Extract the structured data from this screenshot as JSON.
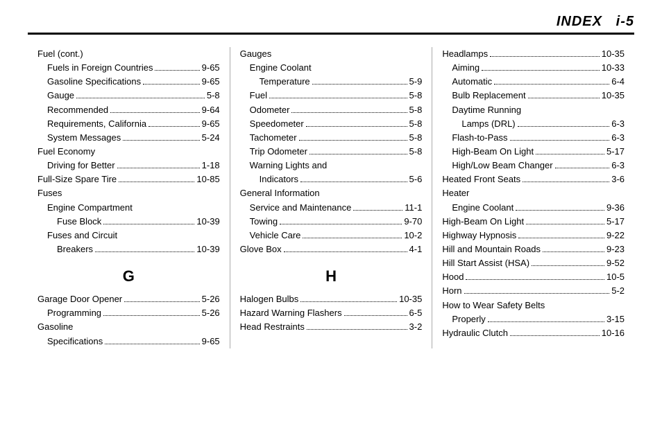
{
  "header": {
    "title": "INDEX",
    "page": "i-5"
  },
  "col1": {
    "entries1": [
      {
        "label": "Fuel (cont.)",
        "page": "",
        "indent": 0,
        "nopage": true
      },
      {
        "label": "Fuels in Foreign Countries",
        "page": "9-65",
        "indent": 1
      },
      {
        "label": "Gasoline Specifications",
        "page": "9-65",
        "indent": 1
      },
      {
        "label": "Gauge",
        "page": "5-8",
        "indent": 1
      },
      {
        "label": "Recommended",
        "page": "9-64",
        "indent": 1
      },
      {
        "label": "Requirements, California",
        "page": "9-65",
        "indent": 1
      },
      {
        "label": "System Messages",
        "page": "5-24",
        "indent": 1
      },
      {
        "label": "Fuel Economy",
        "page": "",
        "indent": 0,
        "nopage": true
      },
      {
        "label": "Driving for Better",
        "page": "1-18",
        "indent": 1
      },
      {
        "label": "Full-Size Spare Tire",
        "page": "10-85",
        "indent": 0
      },
      {
        "label": "Fuses",
        "page": "",
        "indent": 0,
        "nopage": true
      },
      {
        "label": "Engine Compartment",
        "page": "",
        "indent": 1,
        "nopage": true
      },
      {
        "label": "Fuse Block",
        "page": "10-39",
        "indent": 2
      },
      {
        "label": "Fuses and Circuit",
        "page": "",
        "indent": 1,
        "nopage": true
      },
      {
        "label": "Breakers",
        "page": "10-39",
        "indent": 2
      }
    ],
    "letter": "G",
    "entries2": [
      {
        "label": "Garage Door Opener",
        "page": "5-26",
        "indent": 0
      },
      {
        "label": "Programming",
        "page": "5-26",
        "indent": 1
      },
      {
        "label": "Gasoline",
        "page": "",
        "indent": 0,
        "nopage": true
      },
      {
        "label": "Specifications",
        "page": "9-65",
        "indent": 1
      }
    ]
  },
  "col2": {
    "entries1": [
      {
        "label": "Gauges",
        "page": "",
        "indent": 0,
        "nopage": true
      },
      {
        "label": "Engine Coolant",
        "page": "",
        "indent": 1,
        "nopage": true
      },
      {
        "label": "Temperature",
        "page": "5-9",
        "indent": 2
      },
      {
        "label": "Fuel",
        "page": "5-8",
        "indent": 1
      },
      {
        "label": "Odometer",
        "page": "5-8",
        "indent": 1
      },
      {
        "label": "Speedometer",
        "page": "5-8",
        "indent": 1
      },
      {
        "label": "Tachometer",
        "page": "5-8",
        "indent": 1
      },
      {
        "label": "Trip Odometer",
        "page": "5-8",
        "indent": 1
      },
      {
        "label": "Warning Lights and",
        "page": "",
        "indent": 1,
        "nopage": true
      },
      {
        "label": "Indicators",
        "page": "5-6",
        "indent": 2
      },
      {
        "label": "General Information",
        "page": "",
        "indent": 0,
        "nopage": true
      },
      {
        "label": "Service and Maintenance",
        "page": "11-1",
        "indent": 1
      },
      {
        "label": "Towing",
        "page": "9-70",
        "indent": 1
      },
      {
        "label": "Vehicle Care",
        "page": "10-2",
        "indent": 1
      },
      {
        "label": "Glove Box",
        "page": "4-1",
        "indent": 0
      }
    ],
    "letter": "H",
    "entries2": [
      {
        "label": "Halogen Bulbs",
        "page": "10-35",
        "indent": 0
      },
      {
        "label": "Hazard Warning Flashers",
        "page": "6-5",
        "indent": 0
      },
      {
        "label": "Head Restraints",
        "page": "3-2",
        "indent": 0
      }
    ]
  },
  "col3": {
    "entries1": [
      {
        "label": "Headlamps",
        "page": "10-35",
        "indent": 0
      },
      {
        "label": "Aiming",
        "page": "10-33",
        "indent": 1
      },
      {
        "label": "Automatic",
        "page": "6-4",
        "indent": 1
      },
      {
        "label": "Bulb Replacement",
        "page": "10-35",
        "indent": 1
      },
      {
        "label": "Daytime Running",
        "page": "",
        "indent": 1,
        "nopage": true
      },
      {
        "label": "Lamps (DRL)",
        "page": "6-3",
        "indent": 2
      },
      {
        "label": "Flash-to-Pass",
        "page": "6-3",
        "indent": 1
      },
      {
        "label": "High-Beam On Light",
        "page": "5-17",
        "indent": 1
      },
      {
        "label": "High/Low Beam Changer",
        "page": "6-3",
        "indent": 1
      },
      {
        "label": "Heated Front Seats",
        "page": "3-6",
        "indent": 0
      },
      {
        "label": "Heater",
        "page": "",
        "indent": 0,
        "nopage": true
      },
      {
        "label": "Engine Coolant",
        "page": "9-36",
        "indent": 1
      },
      {
        "label": "High-Beam On Light",
        "page": "5-17",
        "indent": 0
      },
      {
        "label": "Highway Hypnosis",
        "page": "9-22",
        "indent": 0
      },
      {
        "label": "Hill and Mountain Roads",
        "page": "9-23",
        "indent": 0
      },
      {
        "label": "Hill Start Assist (HSA)",
        "page": "9-52",
        "indent": 0
      },
      {
        "label": "Hood",
        "page": "10-5",
        "indent": 0
      },
      {
        "label": "Horn",
        "page": "5-2",
        "indent": 0
      },
      {
        "label": "How to Wear Safety Belts",
        "page": "",
        "indent": 0,
        "nopage": true
      },
      {
        "label": "Properly",
        "page": "3-15",
        "indent": 1
      },
      {
        "label": "Hydraulic Clutch",
        "page": "10-16",
        "indent": 0
      }
    ]
  }
}
